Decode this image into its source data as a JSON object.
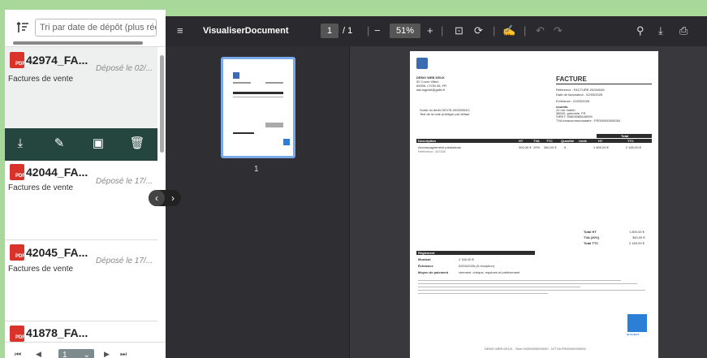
{
  "sort": {
    "placeholder": "Tri par date de dépôt (plus récent)"
  },
  "items": [
    {
      "name": "42974_FA...",
      "date": "Déposé le 02/...",
      "type": "Factures de vente"
    },
    {
      "name": "42044_FA...",
      "date": "Déposé le 17/...",
      "type": "Factures de vente"
    },
    {
      "name": "42045_FA...",
      "date": "Déposé le 17/...",
      "type": "Factures de vente"
    },
    {
      "name": "41878_FA..."
    }
  ],
  "pdf_badge": "PDF",
  "pager": {
    "page": "1"
  },
  "viewer": {
    "title": "VisualiserDocument",
    "page_current": "1",
    "page_total": "/ 1",
    "zoom": "51%",
    "thumb_label": "1"
  },
  "doc": {
    "company": "DEMO WEB DEUX",
    "addr1": "92 Cours Vitton",
    "addr2": "69006, LYON 06, FR",
    "email": "sav.logiciel@gallo.fr",
    "heading": "FACTURE",
    "ref": "Référence : FACTURE-20260045",
    "date": "Date de facturation : 02/03/2026",
    "due": "Échéance : 02/03/2026",
    "client_name": "eoundo",
    "client_addr1": "22 rue martin",
    "client_addr2": "38000, grenoble, FR",
    "client_siret": "SIRET: 50809085645099",
    "client_tva": "TVA intracommunautaire : FR000000000054",
    "note1": "Solde du devis DEVIS-202600040;",
    "note2": "Test de la note publique par défaut",
    "table_total_head": "Total",
    "columns": [
      "Description",
      "HT",
      "TVA",
      "TTC",
      "Quantité",
      "Unité",
      "HT",
      "TTC"
    ],
    "row": [
      "Accompagnement prestations",
      "300,00 €",
      "20%",
      "360,00 €",
      "6",
      "",
      "1 800,00 €",
      "2 160,00 €"
    ],
    "row_ref": "Référence: 437550",
    "totals": [
      [
        "Total HT",
        "1 800,00 €"
      ],
      [
        "TVA (20%)",
        "360,00 €"
      ],
      [
        "Total TTC",
        "2 160,00 €"
      ]
    ],
    "reglement": "Règlement",
    "montant_l": "Montant",
    "montant_v": "2 160,00 €",
    "echeance_l": "Échéance",
    "echeance_v": "02/03/2026 (À réception)",
    "moyen_l": "Moyen de paiement",
    "moyen_v": "virement, chèque, espèces et prélèvement",
    "footer": "DEMO WEB DEUX - Siret 00000000000000 - N°TVA FR00000000000",
    "brand": "QUALIBAT"
  }
}
